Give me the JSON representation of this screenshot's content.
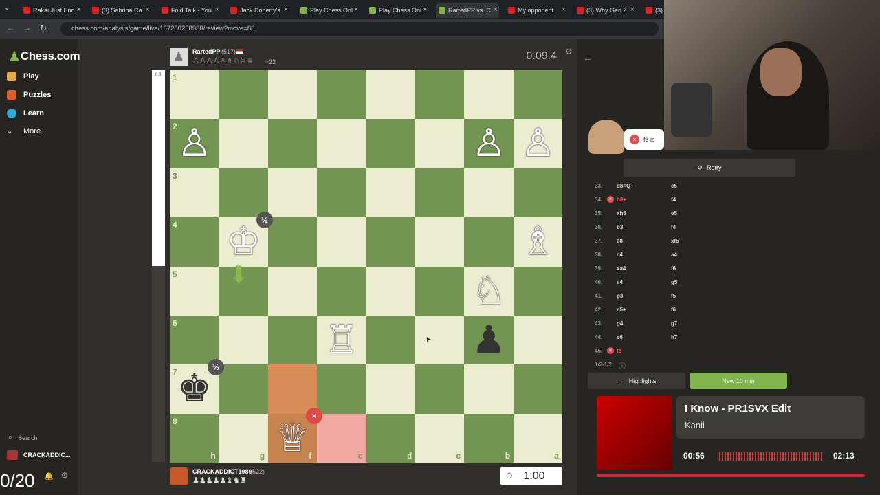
{
  "tabs": [
    {
      "label": "Rakai Just End",
      "color": "#e02020"
    },
    {
      "label": "(3) Sabrina Ca",
      "color": "#e02020"
    },
    {
      "label": "Foid Talk - You",
      "color": "#e02020"
    },
    {
      "label": "Jack Doherty's",
      "color": "#e02020"
    },
    {
      "label": "Play Chess Onl",
      "color": "#81b64c"
    },
    {
      "label": "Play Chess Onl",
      "color": "#81b64c"
    },
    {
      "label": "RartedPP vs. C",
      "color": "#81b64c"
    },
    {
      "label": "My opponent",
      "color": "#e02020"
    },
    {
      "label": "(3) Why Gen Z",
      "color": "#e02020"
    },
    {
      "label": "(3)",
      "color": "#e02020"
    }
  ],
  "url": "chess.com/analysis/game/live/167280258980/review?move=88",
  "sidebar": {
    "logo": "Chess.com",
    "items": [
      {
        "label": "Play"
      },
      {
        "label": "Puzzles"
      },
      {
        "label": "Learn"
      },
      {
        "label": "More"
      }
    ],
    "search": "Search",
    "user": "CRACKADDIC...",
    "counter": "0/20"
  },
  "top_player": {
    "name": "RartedPP",
    "rating": "(517)",
    "captured_extra": "+22",
    "clock": "0:09.4"
  },
  "bottom_player": {
    "name": "CRACKADDICT1989",
    "rating": "(522)",
    "clock": "1:00"
  },
  "eval": "0.0",
  "board": {
    "ranks": [
      "1",
      "2",
      "3",
      "4",
      "5",
      "6",
      "7",
      "8"
    ],
    "files": [
      "h",
      "g",
      "f",
      "e",
      "d",
      "c",
      "b",
      "a"
    ],
    "badges": {
      "king_white": "½",
      "king_black": "½"
    }
  },
  "coach": {
    "text": "f8 is"
  },
  "retry": "Retry",
  "moves": [
    {
      "n": "33.",
      "w": "d8=Q+",
      "b": "e5"
    },
    {
      "n": "34.",
      "w": "h8+",
      "b": "f4"
    },
    {
      "n": "35.",
      "w": "xh5",
      "b": "e5"
    },
    {
      "n": "36.",
      "w": "b3",
      "b": "f4"
    },
    {
      "n": "37.",
      "w": "e8",
      "b": "xf5"
    },
    {
      "n": "38.",
      "w": "c4",
      "b": "a4"
    },
    {
      "n": "39.",
      "w": "xa4",
      "b": "f6"
    },
    {
      "n": "40.",
      "w": "e4",
      "b": "g5"
    },
    {
      "n": "41.",
      "w": "g3",
      "b": "f5"
    },
    {
      "n": "42.",
      "w": "e5+",
      "b": "f6"
    },
    {
      "n": "43.",
      "w": "g4",
      "b": "g7"
    },
    {
      "n": "44.",
      "w": "e6",
      "b": "h7"
    },
    {
      "n": "45.",
      "w": "f8",
      "b": ""
    }
  ],
  "result": "1/2-1/2",
  "highlights": "Highlights",
  "new_game": "New 10 min",
  "music": {
    "title": "I Know - PR1SVX Edit",
    "artist": "Kanii",
    "elapsed": "00:56",
    "total": "02:13",
    "progress": 0.42
  }
}
